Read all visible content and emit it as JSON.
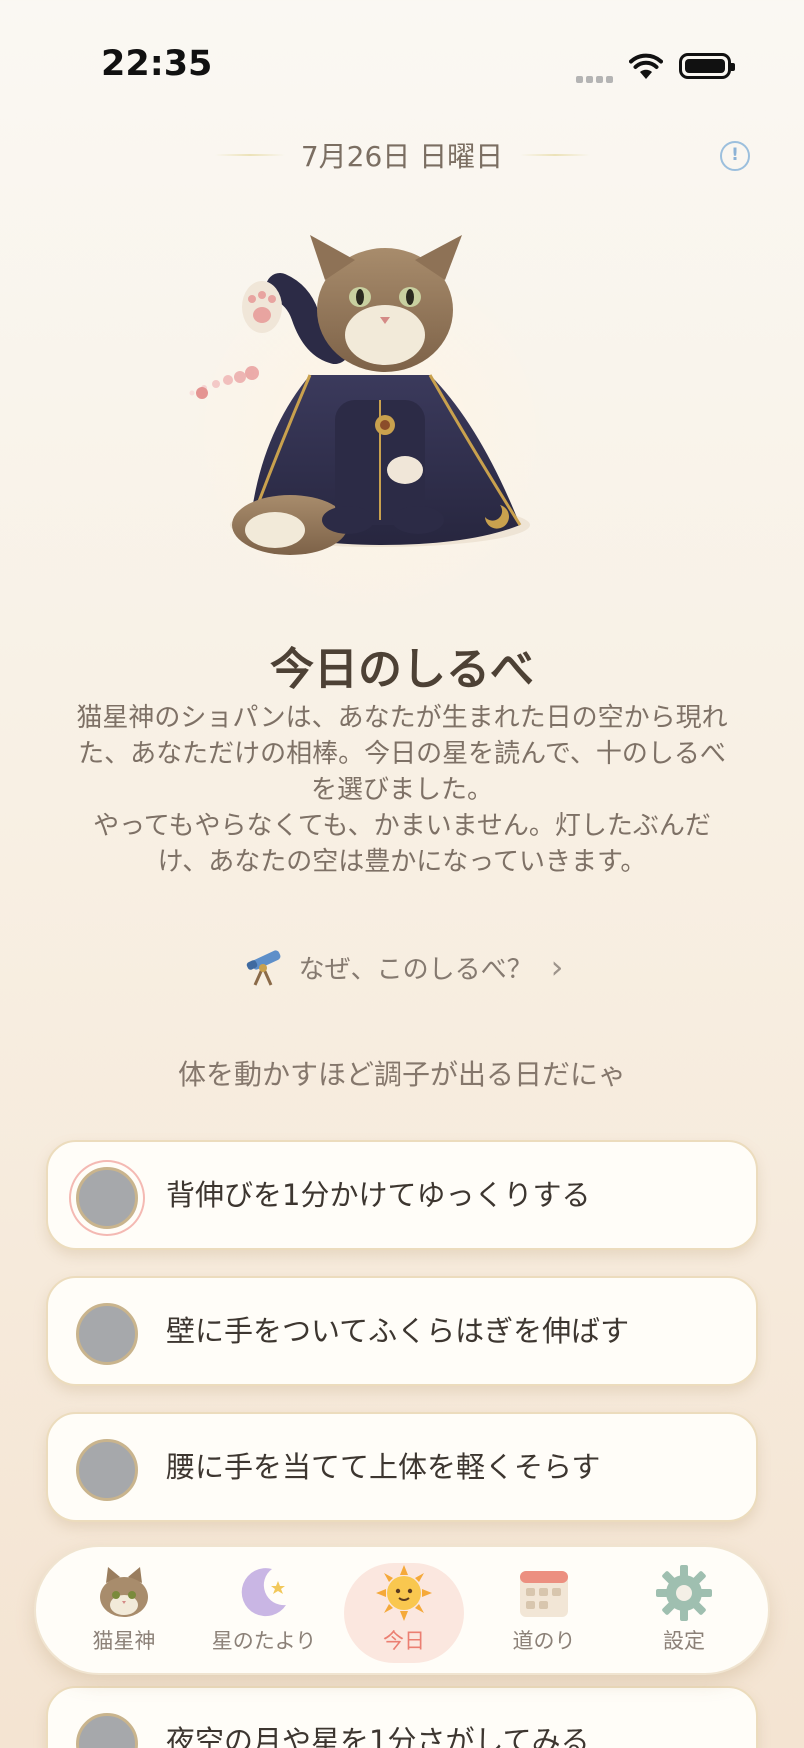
{
  "status_bar": {
    "time": "22:35"
  },
  "header": {
    "date": "7月26日 日曜日",
    "info_icon": "info-icon",
    "info_symbol": "!"
  },
  "hero": {
    "character": "cat-wizard-illustration"
  },
  "content": {
    "heading": "今日のしるべ",
    "intro_lines": [
      "猫星神のショパンは、あなたが生まれた日の空から現れ",
      "た、あなただけの相棒。今日の星を読んで、十のしるべ",
      "を選びました。",
      "やってもやらなくても、かまいません。灯したぶんだ",
      "け、あなたの空は豊かになっていきます。"
    ],
    "why_link": "なぜ、このしるべ？",
    "why_chevron": "›",
    "subtitle": "体を動かすほど調子が出る日だにゃ"
  },
  "tasks": [
    {
      "label": "背伸びを1分かけてゆっくりする",
      "checked": false
    },
    {
      "label": "壁に手をついてふくらはぎを伸ばす",
      "checked": false
    },
    {
      "label": "腰に手を当てて上体を軽くそらす",
      "checked": false
    },
    {
      "label": "夜空の月や星を1分さがしてみる",
      "checked": false
    }
  ],
  "nav": {
    "items": [
      {
        "label": "猫星神",
        "icon": "cat-face-icon"
      },
      {
        "label": "星のたより",
        "icon": "moon-icon"
      },
      {
        "label": "今日",
        "icon": "sun-icon",
        "active": true
      },
      {
        "label": "道のり",
        "icon": "calendar-icon"
      },
      {
        "label": "設定",
        "icon": "gear-icon"
      }
    ]
  },
  "colors": {
    "accent": "#eb7f72",
    "card_border": "#ecdcbd",
    "text": "#3d3630"
  }
}
